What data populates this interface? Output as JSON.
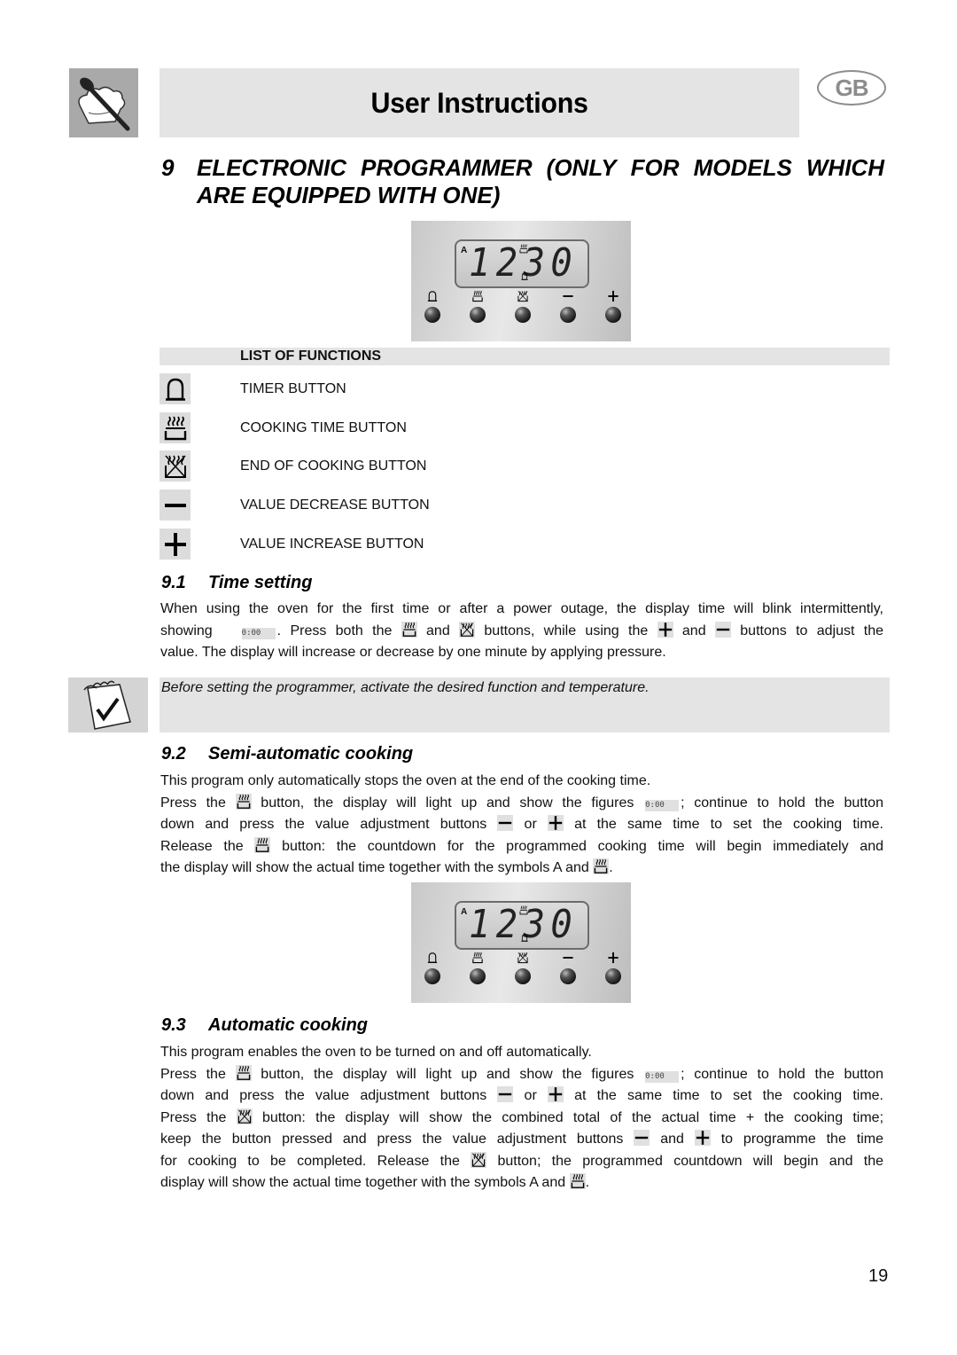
{
  "header": {
    "title": "User Instructions",
    "country_badge": "GB",
    "logo_icon": "chef-spoon-icon"
  },
  "section": {
    "number": "9",
    "title_line1_words": [
      "ELECTRONIC",
      "PROGRAMMER",
      "(ONLY",
      "FOR",
      "MODELS",
      "WHICH"
    ],
    "title_line2": "ARE EQUIPPED WITH ONE)"
  },
  "panel_display": {
    "auto_indicator": "A",
    "time": "1230",
    "buttons": [
      "timer-icon",
      "cooking-time-icon",
      "end-of-cooking-icon",
      "minus-icon",
      "plus-icon"
    ]
  },
  "list_of_functions": {
    "heading": "LIST OF FUNCTIONS",
    "items": [
      {
        "icon": "timer-bell-icon",
        "label": "TIMER BUTTON"
      },
      {
        "icon": "cooking-time-icon",
        "label": "COOKING TIME BUTTON"
      },
      {
        "icon": "end-of-cooking-icon",
        "label": "END OF COOKING BUTTON"
      },
      {
        "icon": "minus-icon",
        "label": "VALUE DECREASE BUTTON"
      },
      {
        "icon": "plus-icon",
        "label": "VALUE INCREASE BUTTON"
      }
    ]
  },
  "lcd_zero": "0:00",
  "s91": {
    "number": "9.1",
    "title": "Time setting",
    "l1": "When using the oven for the first time or after a power outage, the display time will blink intermittently,",
    "l2a": "showing",
    "l2b": ". Press both the",
    "l2c": "and",
    "l2d": "buttons, while using the",
    "l2e": "and",
    "l2f": "buttons to adjust the",
    "l3": "value. The display will increase or decrease by one minute by applying pressure."
  },
  "note": {
    "text": "Before setting the programmer, activate the desired function and temperature.",
    "icon": "notepad-check-icon"
  },
  "s92": {
    "number": "9.2",
    "title": "Semi-automatic cooking",
    "l1": "This program only automatically stops the oven at the end of the cooking time.",
    "l2a": "Press the",
    "l2b": "button, the display will light up and show the figures",
    "l2c": "; continue to hold the button",
    "l3a": "down and press the value adjustment buttons",
    "l3b": "or",
    "l3c": "at the same time to set the cooking time.",
    "l4a": "Release the",
    "l4b": "button: the countdown for the programmed cooking time will begin immediately and",
    "l5a": "the display will show the actual time together with the symbols A and",
    "l5b": "."
  },
  "s93": {
    "number": "9.3",
    "title": "Automatic cooking",
    "l1": "This program enables the oven to be turned on and off automatically.",
    "l2a": "Press the",
    "l2b": "button, the display will light up and show the figures",
    "l2c": "; continue to hold the button",
    "l3a": "down and press the value adjustment buttons",
    "l3b": "or",
    "l3c": "at the same time to set the cooking time.",
    "l4a": "Press the",
    "l4b": "button: the display will show the combined total of the actual time + the cooking time;",
    "l5a": "keep the button pressed and press the value adjustment buttons",
    "l5b": "and",
    "l5c": "to programme the time",
    "l6a": "for cooking to be completed. Release the",
    "l6b": "button; the programmed countdown will begin and the",
    "l7a": "display will show the actual time together with the symbols A and",
    "l7b": "."
  },
  "page_number": "19"
}
